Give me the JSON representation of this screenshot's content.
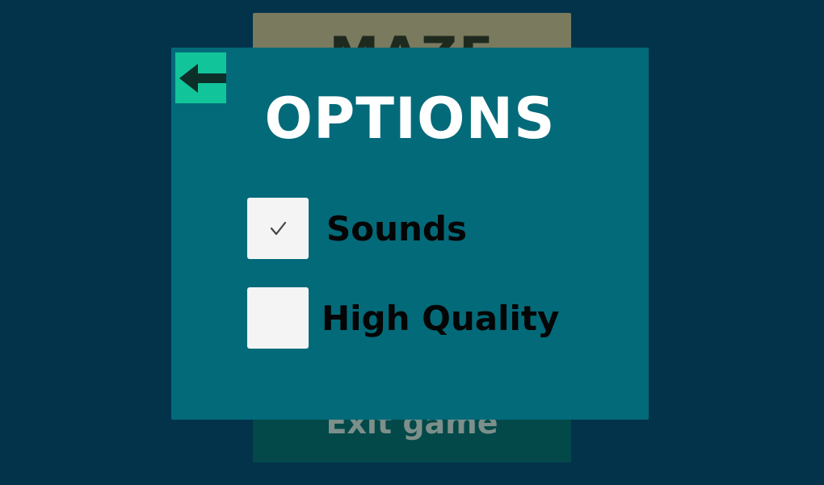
{
  "background_menu": {
    "title": "MAZE",
    "exit_label": "Exit game"
  },
  "options": {
    "title": "OPTIONS",
    "back_icon": "arrow-left-icon",
    "items": [
      {
        "label": "Sounds",
        "checked": true
      },
      {
        "label": "High Quality",
        "checked": false
      }
    ]
  },
  "colors": {
    "page_background": "#03334a",
    "panel": "#036a79",
    "back_button": "#12c49a",
    "checkbox": "#f4f4f4",
    "title_text": "#ffffff",
    "label_text": "#050505"
  }
}
